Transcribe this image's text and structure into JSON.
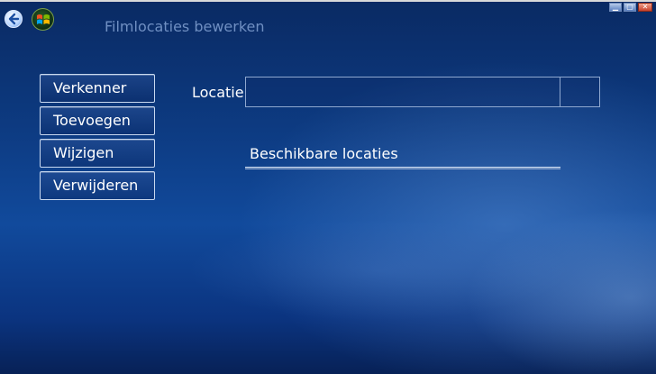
{
  "window": {
    "controls": [
      {
        "name": "minimize",
        "glyph": "▁"
      },
      {
        "name": "maximize",
        "glyph": "▢"
      },
      {
        "name": "close",
        "glyph": "✕"
      }
    ]
  },
  "header": {
    "title": "Filmlocaties bewerken"
  },
  "sidebar": {
    "items": [
      {
        "label": "Verkenner"
      },
      {
        "label": "Toevoegen"
      },
      {
        "label": "Wijzigen"
      },
      {
        "label": "Verwijderen"
      }
    ]
  },
  "form": {
    "location_label": "Locatie",
    "location_value": "",
    "available_header": "Beschikbare locaties",
    "available_items": []
  },
  "colors": {
    "background_top": "#0a2a63",
    "background_mid": "#114a9c",
    "title_text": "#6f8fc2",
    "button_border": "#c9d9f0"
  }
}
